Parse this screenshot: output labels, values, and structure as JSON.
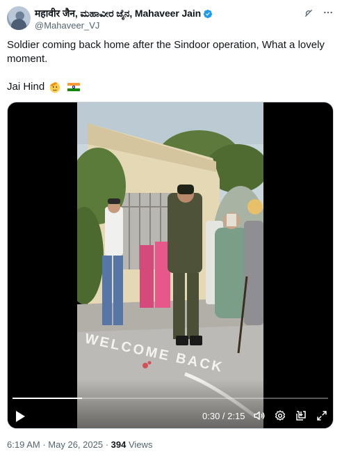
{
  "author": {
    "display_name": "महावीर जैन, ಮಹಾವೀರ ಜೈನ, Mahaveer Jain",
    "handle": "@Mahaveer_VJ",
    "verified": true
  },
  "header_icons": [
    "grok-icon",
    "more-icon"
  ],
  "tweet": {
    "text_line1": "Soldier coming back home after the Sindoor operation, What a lovely moment.",
    "text_line2": "Jai Hind",
    "emojis": [
      "saluting-face-emoji",
      "india-flag-emoji"
    ]
  },
  "video": {
    "time_display": "0:30 / 2:15",
    "progress": 0.22,
    "ground_text": "WELCOME BACK",
    "controls": [
      "play-icon",
      "volume-icon",
      "settings-icon",
      "popout-icon",
      "fullscreen-icon"
    ]
  },
  "meta": {
    "time": "6:19 AM",
    "separator": "·",
    "date": "May 26, 2025",
    "views_count": "394",
    "views_label": "Views"
  },
  "colors": {
    "verified_blue": "#1d9bf0",
    "secondary_text": "#536471",
    "primary_text": "#0f1419"
  }
}
